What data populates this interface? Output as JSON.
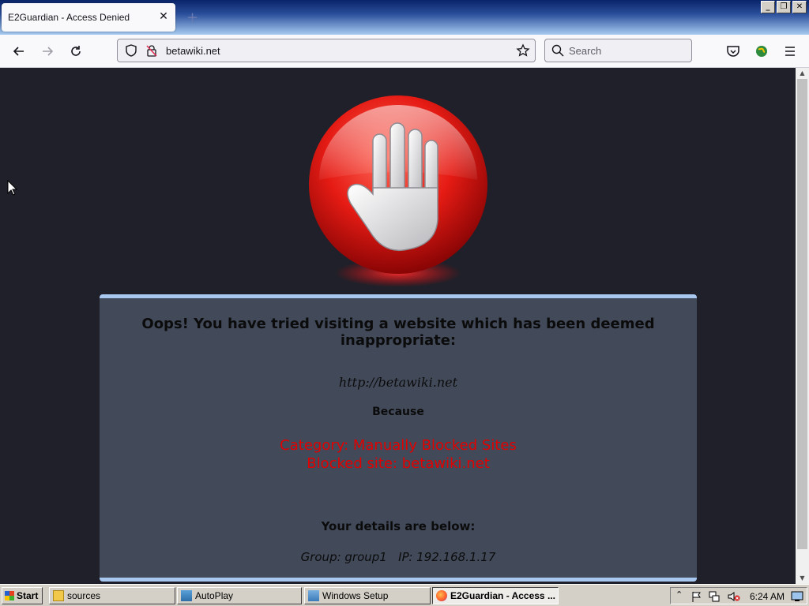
{
  "browser": {
    "tab_title": "E2Guardian - Access Denied",
    "tab_close": "✕",
    "new_tab": "+",
    "url": "betawiki.net",
    "search_placeholder": "Search",
    "window_buttons": [
      "_",
      "❐",
      "✕"
    ]
  },
  "page": {
    "heading": "Oops! You have tried visiting a website which has been deemed inappropriate:",
    "blocked_url": "http://betawiki.net",
    "because_label": "Because",
    "reason_category": "Category: Manually Blocked Sites",
    "reason_site": "Blocked site: betawiki.net",
    "details_label": "Your details are below:",
    "group_ip": "Group: group1   IP: 192.168.1.17"
  },
  "taskbar": {
    "start_label": "Start",
    "items": [
      {
        "label": "sources",
        "icon": "folder-icon"
      },
      {
        "label": "AutoPlay",
        "icon": "autoplay-icon"
      },
      {
        "label": "Windows Setup",
        "icon": "setup-icon"
      },
      {
        "label": "E2Guardian - Access ...",
        "icon": "firefox-icon",
        "active": true
      }
    ],
    "clock": "6:24 AM"
  },
  "colors": {
    "content_bg": "#1f2029",
    "panel_bg": "#424a5a",
    "panel_border": "#a8c8f0",
    "reason_text": "#e00000"
  }
}
